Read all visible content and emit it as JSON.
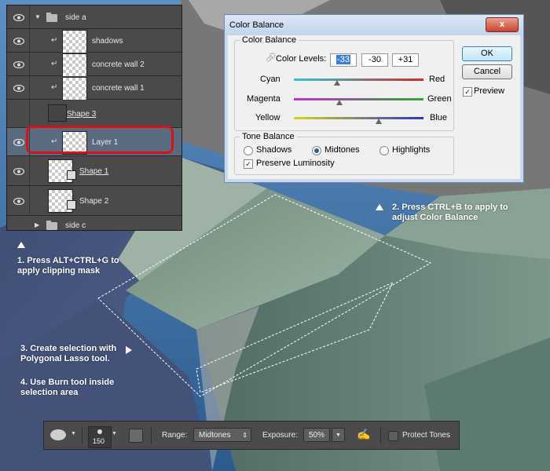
{
  "layers_panel": {
    "layers": [
      {
        "name": "side a",
        "kind": "group",
        "expanded": true
      },
      {
        "name": "shadows",
        "kind": "clipped"
      },
      {
        "name": "concrete wall 2",
        "kind": "clipped"
      },
      {
        "name": "concrete wall 1",
        "kind": "clipped"
      },
      {
        "name": "Shape 3",
        "kind": "shape"
      },
      {
        "name": "Layer 1",
        "kind": "clipped",
        "selected": true
      },
      {
        "name": "Shape 1",
        "kind": "shape"
      },
      {
        "name": "Shape 2",
        "kind": "shape"
      },
      {
        "name": "side c",
        "kind": "group",
        "expanded": false
      }
    ]
  },
  "dialog": {
    "title": "Color Balance",
    "close_label": "x",
    "color_balance_group": "Color Balance",
    "color_levels_label": "Color Levels:",
    "levels": [
      "-33",
      "-30",
      "+31"
    ],
    "sliders": [
      {
        "left": "Cyan",
        "right": "Red",
        "value": -33,
        "left_color": "#2cc6d8",
        "right_color": "#d22a2a"
      },
      {
        "left": "Magenta",
        "right": "Green",
        "value": -30,
        "left_color": "#c42ed0",
        "right_color": "#2ea82e"
      },
      {
        "left": "Yellow",
        "right": "Blue",
        "value": 31,
        "left_color": "#d8d41c",
        "right_color": "#2a36c8"
      }
    ],
    "tone_balance_group": "Tone Balance",
    "tones": [
      {
        "label": "Shadows",
        "selected": false
      },
      {
        "label": "Midtones",
        "selected": true
      },
      {
        "label": "Highlights",
        "selected": false
      }
    ],
    "preserve_luminosity": "Preserve Luminosity",
    "preserve_checked": true,
    "ok_label": "OK",
    "cancel_label": "Cancel",
    "preview_label": "Preview",
    "preview_checked": true
  },
  "notes": {
    "note1": "1. Press ALT+CTRL+G to\napply clipping mask",
    "note2": "2. Press CTRL+B to apply to\nadjust Color Balance",
    "note3": "3. Create selection with\nPolygonal Lasso tool.",
    "note4": "4. Use Burn tool inside\nselection area"
  },
  "options_bar": {
    "brush_size": "150",
    "range_label": "Range:",
    "range_value": "Midtones",
    "exposure_label": "Exposure:",
    "exposure_value": "50%",
    "protect_tones_label": "Protect Tones",
    "protect_tones_checked": false
  },
  "colors": {
    "selection_highlight": "#d41414",
    "panel_bg": "#3b3b3b",
    "selected_layer": "#5a6b80"
  }
}
